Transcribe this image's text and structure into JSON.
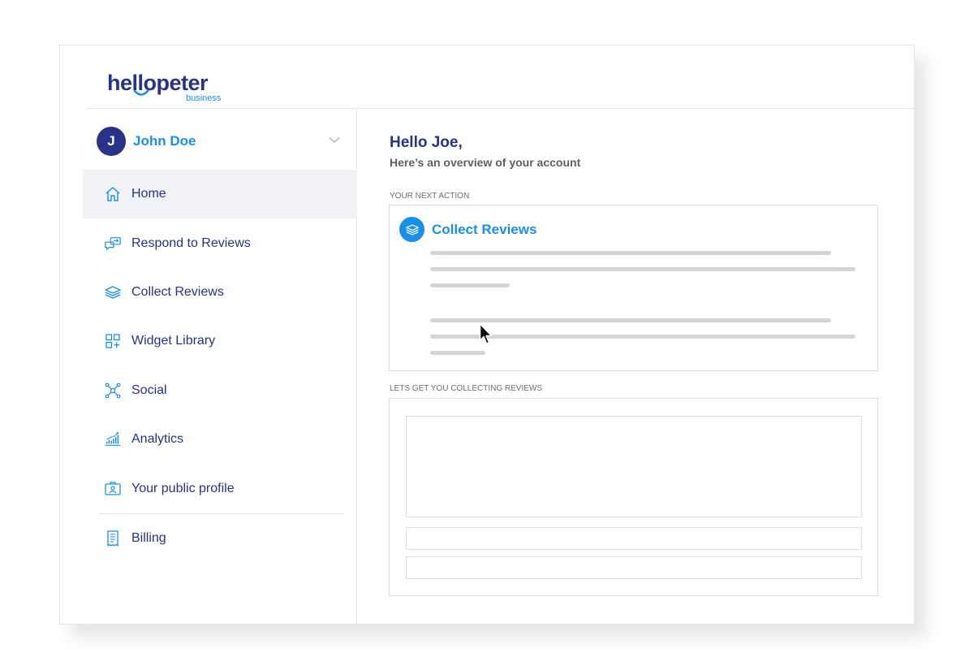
{
  "brand": {
    "logo_word": "hellopeter",
    "logo_sub": "business",
    "primary_color": "#283286",
    "accent_color": "#1a8fe8"
  },
  "user": {
    "initial": "J",
    "name": "John Doe"
  },
  "nav": {
    "items": [
      {
        "label": "Home",
        "icon": "home-icon",
        "active": true
      },
      {
        "label": "Respond to Reviews",
        "icon": "chat-bubbles-icon",
        "active": false
      },
      {
        "label": "Collect Reviews",
        "icon": "stack-layers-icon",
        "active": false
      },
      {
        "label": "Widget Library",
        "icon": "widget-grid-icon",
        "active": false
      },
      {
        "label": "Social",
        "icon": "network-icon",
        "active": false
      },
      {
        "label": "Analytics",
        "icon": "bar-chart-icon",
        "active": false
      },
      {
        "label": "Your public profile",
        "icon": "profile-card-icon",
        "active": false
      },
      {
        "label": "Billing",
        "icon": "receipt-icon",
        "active": false
      }
    ]
  },
  "main": {
    "greeting": "Hello Joe,",
    "subtitle": "Here’s an overview of your account",
    "next_action_label": "YOUR NEXT ACTION",
    "next_action_title": "Collect Reviews",
    "collecting_label": "LETS GET YOU COLLECTING REVIEWS"
  }
}
